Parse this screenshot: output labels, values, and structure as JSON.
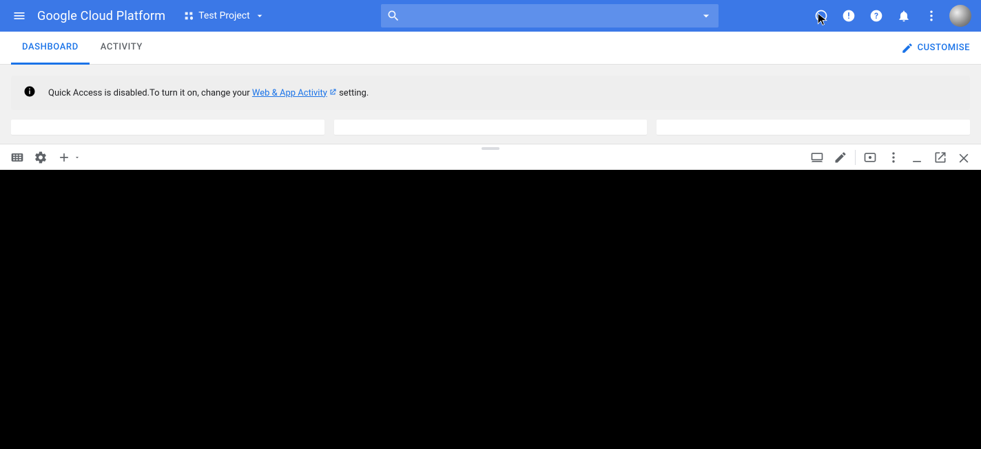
{
  "header": {
    "logo": "Google Cloud Platform",
    "project_name": "Test Project",
    "search_placeholder": ""
  },
  "tabs": {
    "dashboard": "DASHBOARD",
    "activity": "ACTIVITY",
    "customise": "CUSTOMISE"
  },
  "banner": {
    "text_pre": "Quick Access is disabled.To turn it on, change your ",
    "link_text": "Web & App Activity",
    "text_post": "  setting."
  },
  "colors": {
    "header": "#3b78e7",
    "accent": "#1a73e8",
    "content_bg": "#f1f1f1",
    "terminal_bg": "#000000"
  }
}
